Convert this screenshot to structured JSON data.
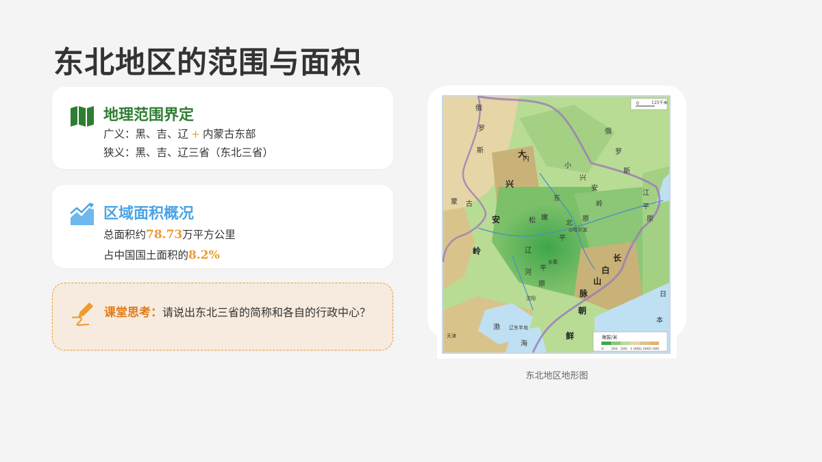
{
  "title": "东北地区的范围与面积",
  "scope_card": {
    "heading": "地理范围界定",
    "broad_prefix": "广义：黑、吉、辽",
    "plus": "+",
    "broad_suffix": "内蒙古东部",
    "narrow": "狭义：黑、吉、辽三省（东北三省）",
    "icon": "map-icon",
    "color": "#2e7d32"
  },
  "area_card": {
    "heading": "区域面积概况",
    "total_prefix": "总面积约",
    "total_value": "78.73",
    "total_suffix": "万平方公里",
    "share_prefix": "占中国国土面积的",
    "share_value": "8.2%",
    "icon": "area-chart-icon",
    "color": "#4aa3e6"
  },
  "think_card": {
    "label": "课堂思考：",
    "question": "请说出东北三省的简称和各自的行政中心？",
    "icon": "pencil-icon",
    "accent": "#ee9a2f"
  },
  "map": {
    "caption": "东北地区地形图",
    "scale_label": "125千米",
    "scale_zero": "0",
    "legend_title": "海拔/米",
    "legend_ticks": [
      "0",
      "200",
      "500",
      "1 000",
      "2 000",
      "3 000"
    ],
    "labels": {
      "e": "俄",
      "luo": "罗",
      "si": "斯",
      "e2": "俄",
      "luo2": "罗",
      "si2": "斯",
      "da": "大",
      "xing": "兴",
      "an": "安",
      "ling": "岭",
      "meng": "蒙",
      "gu": "古",
      "xiao": "小",
      "xing2": "兴",
      "an2": "安",
      "ling2": "岭",
      "dong": "东",
      "bei": "北",
      "ping": "平",
      "yuan": "原",
      "song": "松",
      "nen": "嫩",
      "harbin": "◎哈尔滨",
      "changchun": "长春",
      "shenyang": "沈阳",
      "liao": "辽",
      "he": "河",
      "ping2": "平",
      "yuan2": "原",
      "chang": "长",
      "bai": "白",
      "shan": "山",
      "mai": "脉",
      "chao": "朝",
      "xian": "鲜",
      "bohai": "渤",
      "hai": "海",
      "liaodong": "辽东半岛",
      "jiang": "江",
      "ping3": "平",
      "yuan3": "原",
      "tianjin": "天津",
      "ri": "日",
      "ben": "本",
      "nei": "内"
    }
  }
}
